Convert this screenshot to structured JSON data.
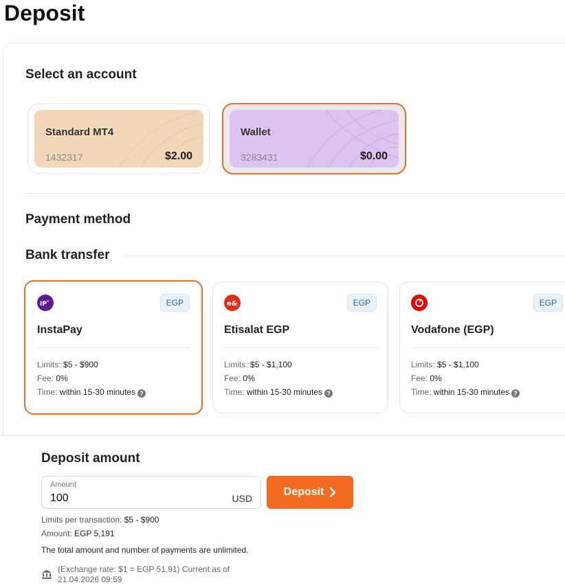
{
  "page": {
    "title": "Deposit"
  },
  "accounts": {
    "section_title": "Select an account",
    "items": [
      {
        "name": "Standard MT4",
        "number": "1432317",
        "balance": "$2.00",
        "selected": false,
        "color": "#f2d8b8"
      },
      {
        "name": "Wallet",
        "number": "3283431",
        "balance": "$0.00",
        "selected": true,
        "color": "#dcc3f0"
      }
    ]
  },
  "payment": {
    "section_title": "Payment method",
    "group_title": "Bank transfer",
    "limits_label": "Limits:",
    "fee_label": "Fee:",
    "time_label": "Time:",
    "methods": [
      {
        "name": "InstaPay",
        "currency": "EGP",
        "limits": "$5 - $900",
        "fee": "0%",
        "time": "within 15-30 minutes",
        "icon": "instapay-logo",
        "selected": true
      },
      {
        "name": "Etisalat EGP",
        "currency": "EGP",
        "limits": "$5 - $1,100",
        "fee": "0%",
        "time": "within 15-30 minutes",
        "icon": "etisalat-logo",
        "selected": false
      },
      {
        "name": "Vodafone (EGP)",
        "currency": "EGP",
        "limits": "$5 - $1,100",
        "fee": "0%",
        "time": "within 15-30 minutes",
        "icon": "vodafone-logo",
        "selected": false
      }
    ]
  },
  "deposit_amount": {
    "title": "Deposit amount",
    "field_label": "Amount",
    "value": "100",
    "currency": "USD",
    "button_label": "Deposit",
    "limits_label": "Limits per transaction:",
    "limits_value": "$5 - $900",
    "amount_label": "Amount:",
    "amount_value": "EGP 5,191",
    "unlimited_note": "The total amount and number of payments are unlimited.",
    "exchange_line1": "(Exchange rate: $1 = EGP 51.91) Current as of",
    "exchange_line2": "21.04.2026 09:59",
    "icon": "bank-icon"
  },
  "colors": {
    "accent": "#f26b21",
    "badge_text": "#2b63b8"
  }
}
